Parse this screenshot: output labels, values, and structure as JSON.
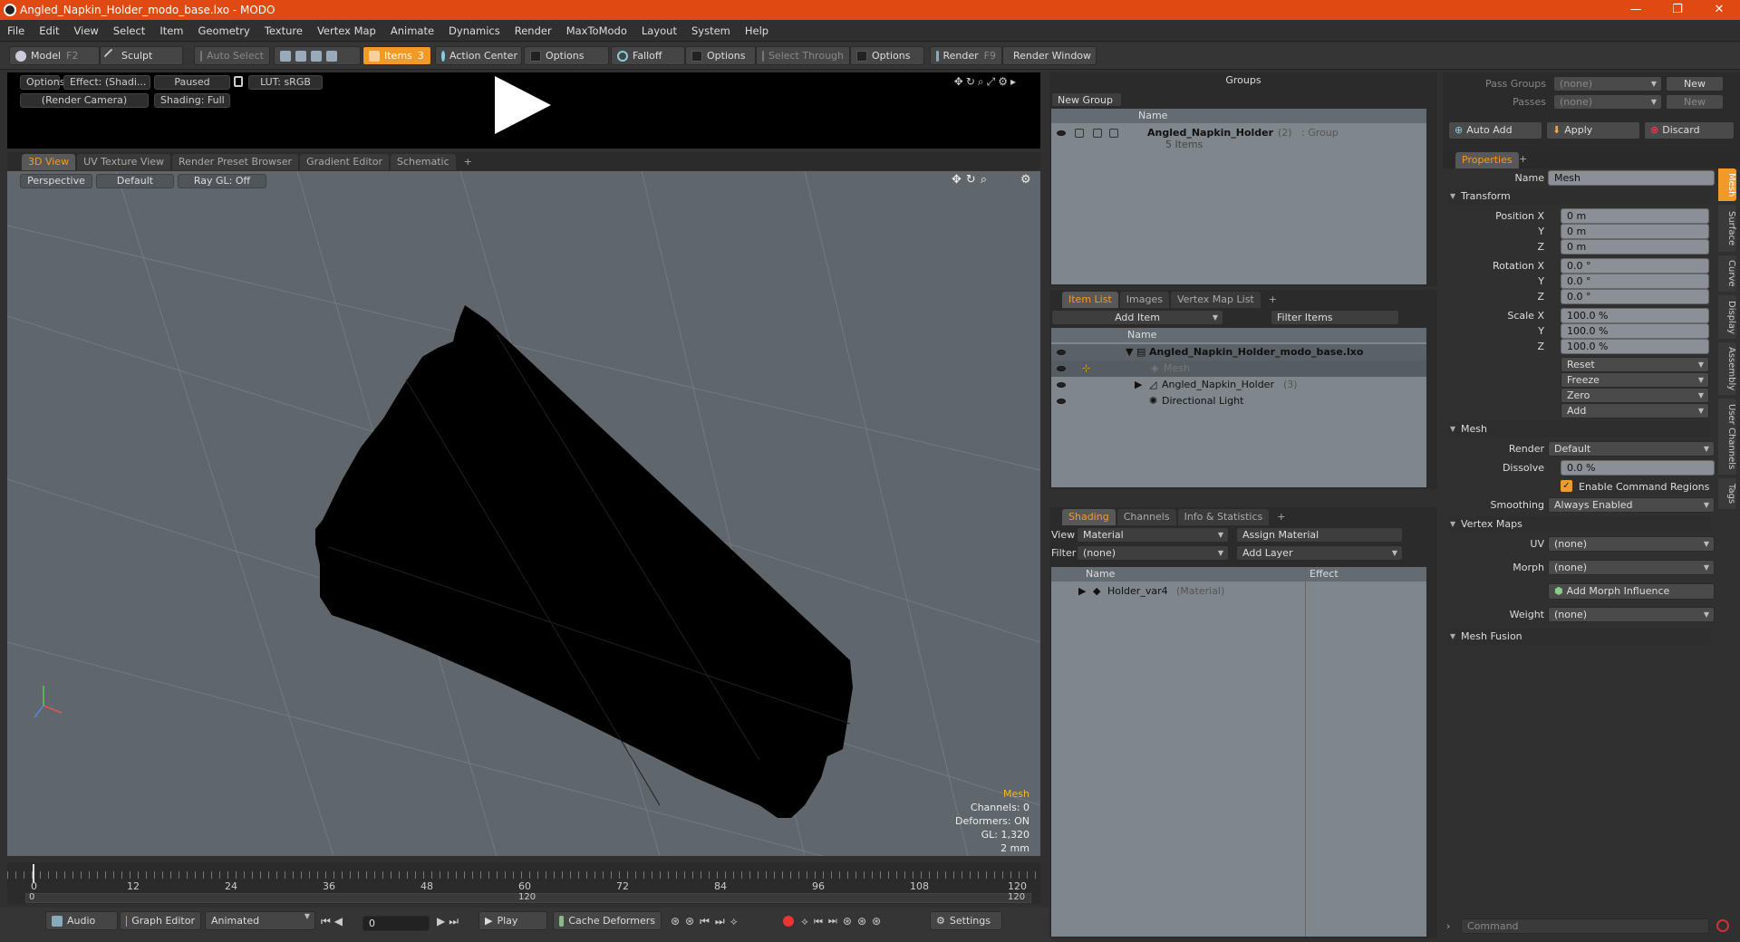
{
  "window": {
    "title": "Angled_Napkin_Holder_modo_base.lxo - MODO",
    "controls": [
      "—",
      "❐",
      "✕"
    ]
  },
  "menu": [
    "File",
    "Edit",
    "View",
    "Select",
    "Item",
    "Geometry",
    "Texture",
    "Vertex Map",
    "Animate",
    "Dynamics",
    "Render",
    "MaxToModo",
    "Layout",
    "System",
    "Help"
  ],
  "toolbar": {
    "model": "Model",
    "model_key": "F2",
    "sculpt": "Sculpt",
    "auto_select": "Auto Select",
    "items": "Items",
    "items_key": "3",
    "action_center": "Action Center",
    "options1": "Options",
    "falloff": "Falloff",
    "options2": "Options",
    "select_through": "Select Through",
    "options3": "Options",
    "render": "Render",
    "render_key": "F9",
    "render_window": "Render Window"
  },
  "preview": {
    "options": "Options",
    "effect": "Effect: (Shadi...",
    "paused": "Paused",
    "lut": "LUT: sRGB",
    "camera": "(Render Camera)",
    "shading": "Shading: Full"
  },
  "viewtabs": [
    "3D View",
    "UV Texture View",
    "Render Preset Browser",
    "Gradient Editor",
    "Schematic",
    "+"
  ],
  "viewport": {
    "perspective": "Perspective",
    "default": "Default",
    "raygl": "Ray GL: Off",
    "hud": {
      "mesh": "Mesh",
      "channels": "Channels: 0",
      "deformers": "Deformers: ON",
      "gl": "GL: 1,320",
      "unit": "2 mm"
    }
  },
  "timeline": {
    "ticks": [
      "0",
      "12",
      "24",
      "36",
      "48",
      "60",
      "72",
      "84",
      "96",
      "108",
      "120"
    ],
    "start": "0",
    "mid": "120",
    "end": "120"
  },
  "bottombar": {
    "audio": "Audio",
    "graph_editor": "Graph Editor",
    "animated": "Animated",
    "frame": "0",
    "play": "Play",
    "cache": "Cache Deformers",
    "settings": "Settings"
  },
  "groups": {
    "title": "Groups",
    "new_group": "New Group",
    "col_name": "Name",
    "item_name": "Angled_Napkin_Holder",
    "item_count": "(2)",
    "item_type": ": Group",
    "item_sub": "5 Items"
  },
  "itemlist": {
    "tabs": [
      "Item List",
      "Images",
      "Vertex Map List",
      "+"
    ],
    "add_item": "Add Item",
    "filter": "Filter Items",
    "col_name": "Name",
    "rows": [
      {
        "name": "Angled_Napkin_Holder_modo_base.lxo",
        "extra": ""
      },
      {
        "name": "Mesh",
        "extra": ""
      },
      {
        "name": "Angled_Napkin_Holder",
        "extra": "(3)"
      },
      {
        "name": "Directional Light",
        "extra": ""
      }
    ]
  },
  "shading": {
    "tabs": [
      "Shading",
      "Channels",
      "Info & Statistics",
      "+"
    ],
    "view_label": "View",
    "view_value": "Material",
    "assign": "Assign Material",
    "filter_label": "Filter",
    "filter_value": "(none)",
    "add_layer": "Add Layer",
    "col_name": "Name",
    "col_effect": "Effect",
    "row_name": "Holder_var4",
    "row_type": "(Material)"
  },
  "passes": {
    "pass_groups": "Pass Groups",
    "passes": "Passes",
    "none": "(none)",
    "new": "New",
    "auto_add": "Auto Add",
    "apply": "Apply",
    "discard": "Discard"
  },
  "properties": {
    "tab": "Properties",
    "plus": "+",
    "name_label": "Name",
    "name_value": "Mesh",
    "transform": "Transform",
    "pos_x_label": "Position X",
    "y": "Y",
    "z": "Z",
    "pos": [
      "0 m",
      "0 m",
      "0 m"
    ],
    "rot_x_label": "Rotation X",
    "rot": [
      "0.0 °",
      "0.0 °",
      "0.0 °"
    ],
    "scale_x_label": "Scale X",
    "scale": [
      "100.0 %",
      "100.0 %",
      "100.0 %"
    ],
    "reset": "Reset",
    "freeze": "Freeze",
    "zero": "Zero",
    "add": "Add",
    "mesh": "Mesh",
    "render_label": "Render",
    "render_value": "Default",
    "dissolve_label": "Dissolve",
    "dissolve_value": "0.0 %",
    "enable_cmd": "Enable Command Regions",
    "smoothing_label": "Smoothing",
    "smoothing_value": "Always Enabled",
    "vertex_maps": "Vertex Maps",
    "uv_label": "UV",
    "uv_value": "(none)",
    "morph_label": "Morph",
    "morph_value": "(none)",
    "add_morph": "Add Morph Influence",
    "weight_label": "Weight",
    "weight_value": "(none)",
    "mesh_fusion": "Mesh Fusion",
    "side_tabs": [
      "Mesh",
      "Surface",
      "Curve",
      "Display",
      "Assembly",
      "User Channels",
      "Tags"
    ],
    "command": "Command"
  },
  "colors": {
    "title_bar": "#e04a12",
    "accent": "#f29a29",
    "viewport": "#5f666c",
    "mesh": "#000000"
  }
}
